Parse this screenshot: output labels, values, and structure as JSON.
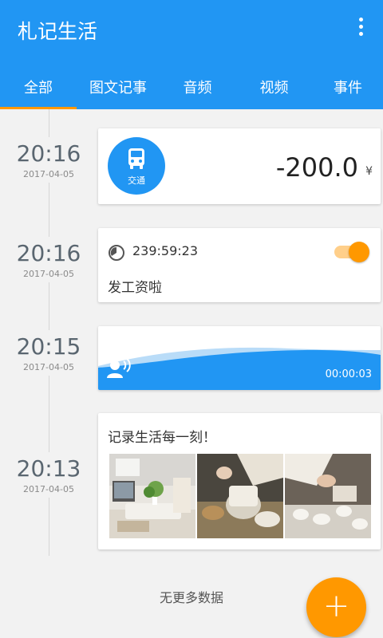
{
  "app": {
    "title": "札记生活"
  },
  "tabs": [
    {
      "label": "全部",
      "active": true
    },
    {
      "label": "图文记事"
    },
    {
      "label": "音频"
    },
    {
      "label": "视频"
    },
    {
      "label": "事件"
    }
  ],
  "entries": [
    {
      "time": "20:16",
      "date": "2017-04-05",
      "type": "expense",
      "category": "交通",
      "icon": "bus-icon",
      "amount": "-200.0",
      "currency": "¥"
    },
    {
      "time": "20:16",
      "date": "2017-04-05",
      "type": "event",
      "icon": "clock-icon",
      "duration": "239:59:23",
      "text": "发工资啦",
      "toggle_on": true
    },
    {
      "time": "20:15",
      "date": "2017-04-05",
      "type": "audio",
      "icon": "listen-icon",
      "audio_duration": "00:00:03"
    },
    {
      "time": "20:13",
      "date": "2017-04-05",
      "type": "photo",
      "title": "记录生活每一刻！",
      "photos": [
        "living-room-photo",
        "tea-set-photo",
        "tea-cups-photo"
      ]
    }
  ],
  "footer": {
    "text": "无更多数据"
  },
  "fab": {
    "symbol": "+"
  },
  "colors": {
    "primary": "#2196f3",
    "accent": "#ff9800",
    "background": "#f2f2f2"
  }
}
